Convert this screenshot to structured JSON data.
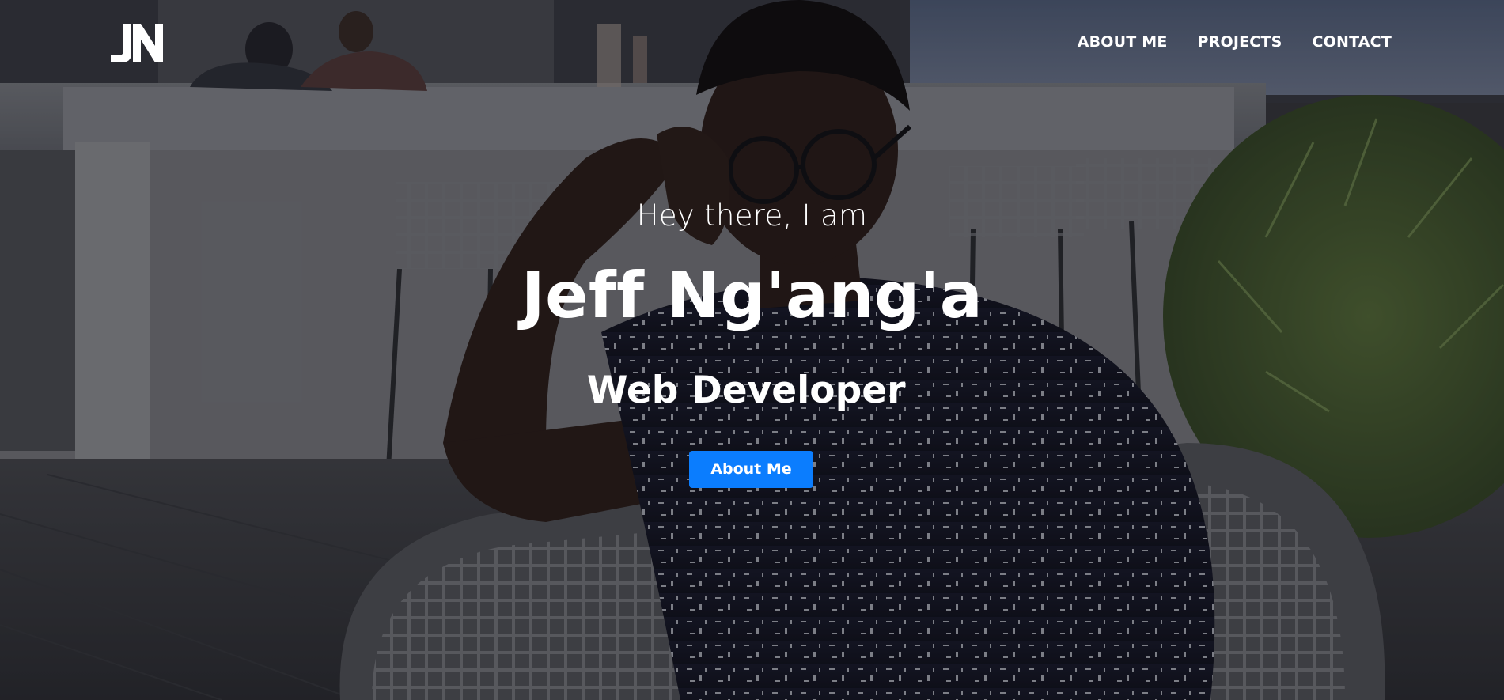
{
  "brand": {
    "logo_text": "JN",
    "logo_color": "#ffffff"
  },
  "nav": {
    "items": [
      {
        "label": "ABOUT ME"
      },
      {
        "label": "PROJECTS"
      },
      {
        "label": "CONTACT"
      }
    ]
  },
  "hero": {
    "greeting": "Hey there, I am",
    "name": "Jeff Ng'ang'a",
    "role": "Web Developer",
    "cta_label": "About Me",
    "cta_color": "#0b7dfe",
    "background": "photo-of-person-seated-on-terrace"
  }
}
